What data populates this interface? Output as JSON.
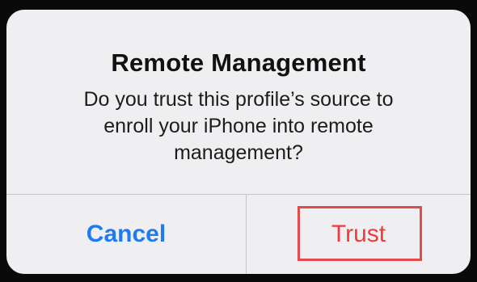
{
  "dialog": {
    "title": "Remote Management",
    "message": "Do you trust this profile’s source to\nenroll your iPhone into remote\nmanagement?",
    "buttons": {
      "cancel_label": "Cancel",
      "trust_label": "Trust"
    }
  },
  "colors": {
    "cancel_text": "#1e7cf3",
    "trust_text": "#ee3b3b",
    "highlight_border": "#e24b4b",
    "dialog_background": "#efeff1"
  }
}
